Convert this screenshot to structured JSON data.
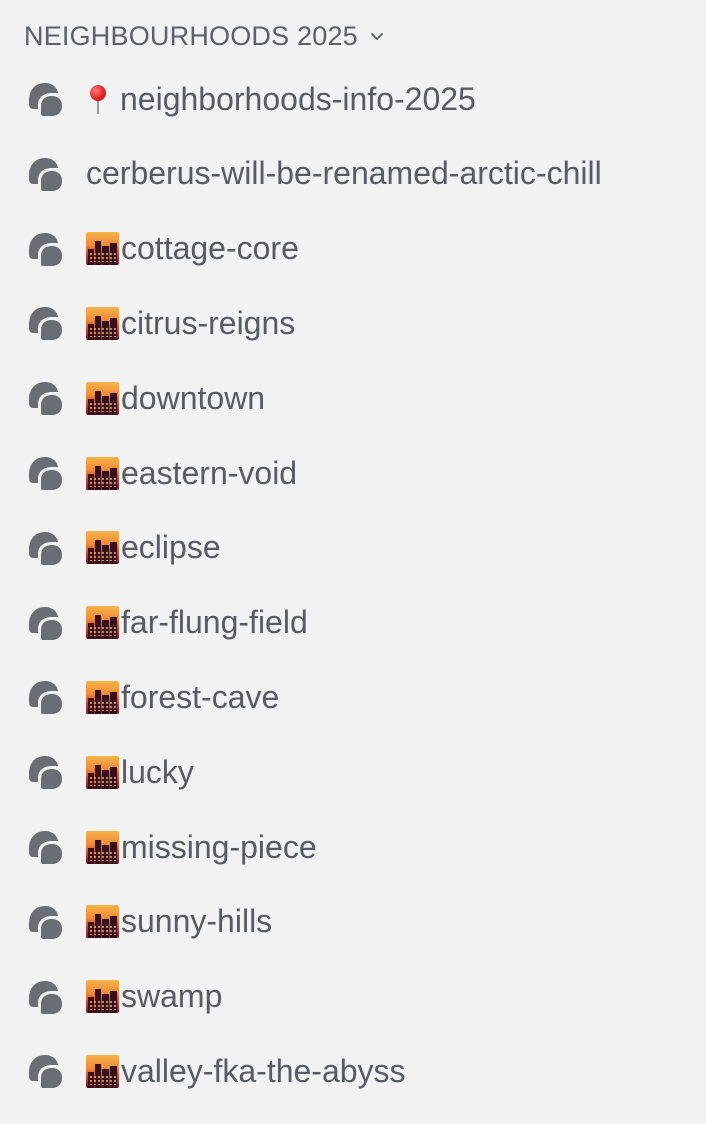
{
  "category": {
    "label": "NEIGHBOURHOODS 2025",
    "collapse_icon": "chevron-down-icon"
  },
  "colors": {
    "background": "#f2f2f3",
    "text": "#595b64",
    "icon": "#6b6d75"
  },
  "channels": [
    {
      "name": "neighborhoods-info-2025",
      "emoji": "round-pushpin-icon",
      "icon": "forum-icon"
    },
    {
      "name": "cerberus-will-be-renamed-arctic-chill",
      "emoji": "",
      "icon": "forum-icon"
    },
    {
      "name": "cottage-core",
      "emoji": "city-sunset-icon",
      "icon": "forum-icon"
    },
    {
      "name": "citrus-reigns",
      "emoji": "city-sunset-icon",
      "icon": "forum-icon"
    },
    {
      "name": "downtown",
      "emoji": "city-sunset-icon",
      "icon": "forum-icon"
    },
    {
      "name": "eastern-void",
      "emoji": "city-sunset-icon",
      "icon": "forum-icon"
    },
    {
      "name": "eclipse",
      "emoji": "city-sunset-icon",
      "icon": "forum-icon"
    },
    {
      "name": "far-flung-field",
      "emoji": "city-sunset-icon",
      "icon": "forum-icon"
    },
    {
      "name": "forest-cave",
      "emoji": "city-sunset-icon",
      "icon": "forum-icon"
    },
    {
      "name": "lucky",
      "emoji": "city-sunset-icon",
      "icon": "forum-icon"
    },
    {
      "name": "missing-piece",
      "emoji": "city-sunset-icon",
      "icon": "forum-icon"
    },
    {
      "name": "sunny-hills",
      "emoji": "city-sunset-icon",
      "icon": "forum-icon"
    },
    {
      "name": "swamp",
      "emoji": "city-sunset-icon",
      "icon": "forum-icon"
    },
    {
      "name": "valley-fka-the-abyss",
      "emoji": "city-sunset-icon",
      "icon": "forum-icon"
    }
  ]
}
